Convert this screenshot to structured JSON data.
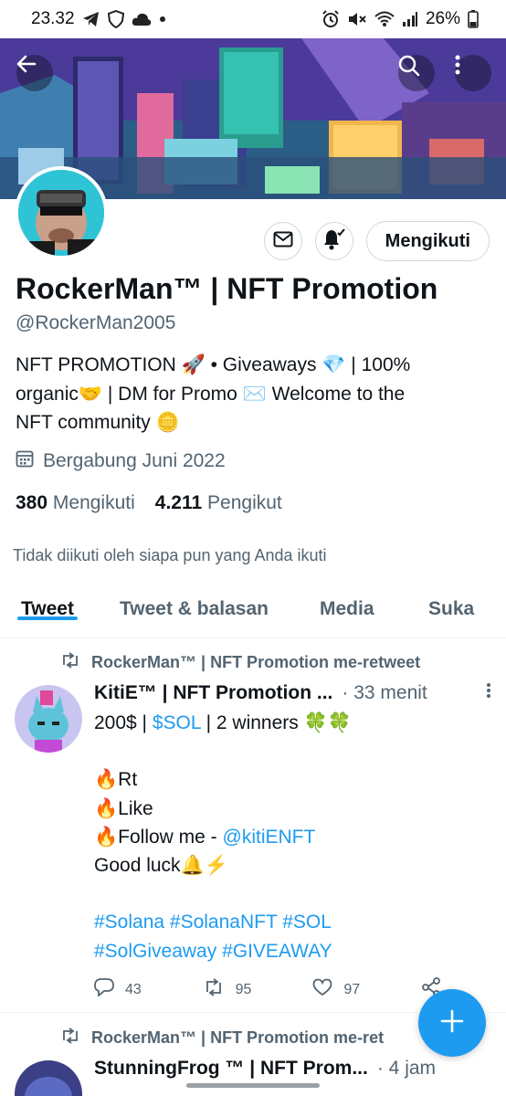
{
  "status_bar": {
    "time": "23.32",
    "battery": "26%",
    "icons": [
      "telegram-icon",
      "shield-icon",
      "cloud-icon",
      "dot-icon",
      "alarm-icon",
      "mute-icon",
      "wifi-icon",
      "signal-icon",
      "battery-icon"
    ]
  },
  "banner": {
    "back_icon": "back-arrow-icon",
    "search_icon": "search-icon",
    "more_icon": "more-vertical-icon"
  },
  "profile": {
    "name": "RockerMan™ | NFT Promotion",
    "handle": "@RockerMan2005",
    "bio_line1": "NFT PROMOTION 🚀 • Giveaways 💎 | 100%",
    "bio_line2": "organic🤝 | DM for Promo ✉️ Welcome to the",
    "bio_line3": "NFT community 🪙",
    "joined": "Bergabung Juni 2022",
    "following_count": "380",
    "following_label": "Mengikuti",
    "followers_count": "4.211",
    "followers_label": "Pengikut",
    "not_followed": "Tidak diikuti oleh siapa pun yang Anda ikuti",
    "follow_button": "Mengikuti"
  },
  "tabs": [
    "Tweet",
    "Tweet & balasan",
    "Media",
    "Suka"
  ],
  "tweets": [
    {
      "retweet_line": "RockerMan™ | NFT Promotion me-retweet",
      "author": "KitiE™ | NFT Promotion ...",
      "time": "· 33 menit",
      "body": {
        "l1_pre": "200$ | ",
        "l1_link": "$SOL",
        "l1_post": " | 2 winners 🍀🍀",
        "l2": "🔥Rt",
        "l3": "🔥Like",
        "l4_pre": "🔥Follow me - ",
        "l4_link": "@kitiENFT",
        "l5": "Good luck🔔⚡",
        "l6": "#Solana #SolanaNFT #SOL",
        "l7": "#SolGiveaway #GIVEAWAY"
      },
      "replies": "43",
      "retweets": "95",
      "likes": "97"
    },
    {
      "retweet_line": "RockerMan™ | NFT Promotion me-ret",
      "author": "StunningFrog ™ | NFT Prom...",
      "time": "· 4 jam"
    }
  ],
  "colors": {
    "accent": "#1d9bf0",
    "text": "#0f1419",
    "muted": "#536471",
    "border": "#cfd9de"
  }
}
